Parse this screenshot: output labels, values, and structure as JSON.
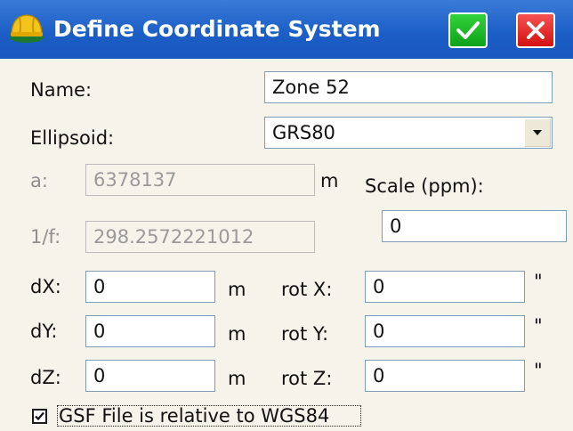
{
  "window": {
    "title": "Define Coordinate System",
    "icon": "hardhat-app-icon",
    "ok_icon": "checkmark-icon",
    "cancel_icon": "close-x-icon"
  },
  "colors": {
    "titlebar": "#1c5fc6",
    "ok": "#12b01f",
    "cancel": "#e01e1e",
    "background": "#f5f3ea"
  },
  "form": {
    "name_label": "Name:",
    "name_value": "Zone 52",
    "ellipsoid_label": "Ellipsoid:",
    "ellipsoid_value": "GRS80",
    "a_label": "a:",
    "a_value": "6378137",
    "a_unit": "m",
    "f_label": "1/f:",
    "f_value": "298.2572221012",
    "scale_label": "Scale (ppm):",
    "scale_value": "0",
    "dx_label": "dX:",
    "dx_value": "0",
    "dx_unit": "m",
    "dy_label": "dY:",
    "dy_value": "0",
    "dy_unit": "m",
    "dz_label": "dZ:",
    "dz_value": "0",
    "dz_unit": "m",
    "rotx_label": "rot X:",
    "rotx_value": "0",
    "rotx_unit": "\"",
    "roty_label": "rot Y:",
    "roty_value": "0",
    "roty_unit": "\"",
    "rotz_label": "rot Z:",
    "rotz_value": "0",
    "rotz_unit": "\"",
    "gsf_label": "GSF File is relative to WGS84",
    "gsf_checked": true
  }
}
